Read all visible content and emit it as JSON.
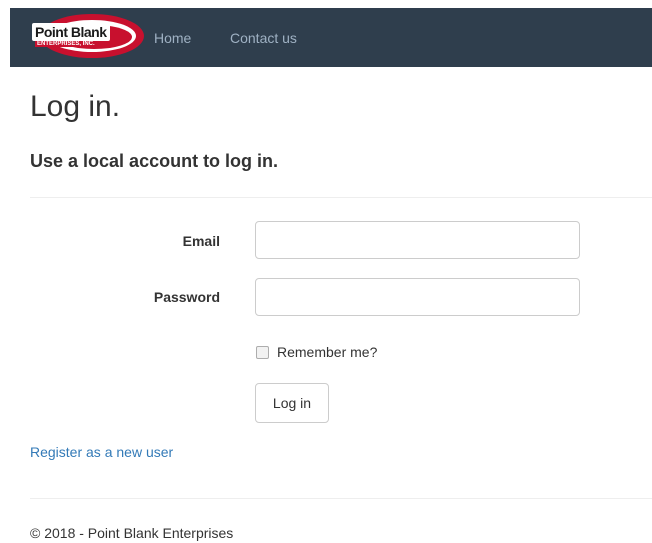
{
  "navbar": {
    "logo_text": "Point Blank",
    "logo_sub": "ENTERPRISES, INC.",
    "links": [
      {
        "label": "Home"
      },
      {
        "label": "Contact us"
      }
    ]
  },
  "page": {
    "title": "Log in.",
    "subtitle": "Use a local account to log in."
  },
  "form": {
    "email_label": "Email",
    "email_value": "",
    "password_label": "Password",
    "password_value": "",
    "remember_label": "Remember me?",
    "remember_checked": false,
    "submit_label": "Log in"
  },
  "register_link": "Register as a new user",
  "footer": {
    "text": "© 2018 - Point Blank Enterprises"
  },
  "colors": {
    "navbar": "#2f3e4d",
    "link": "#337ab7",
    "nav_link": "#9fb1c3",
    "logo_red": "#c8102e"
  }
}
